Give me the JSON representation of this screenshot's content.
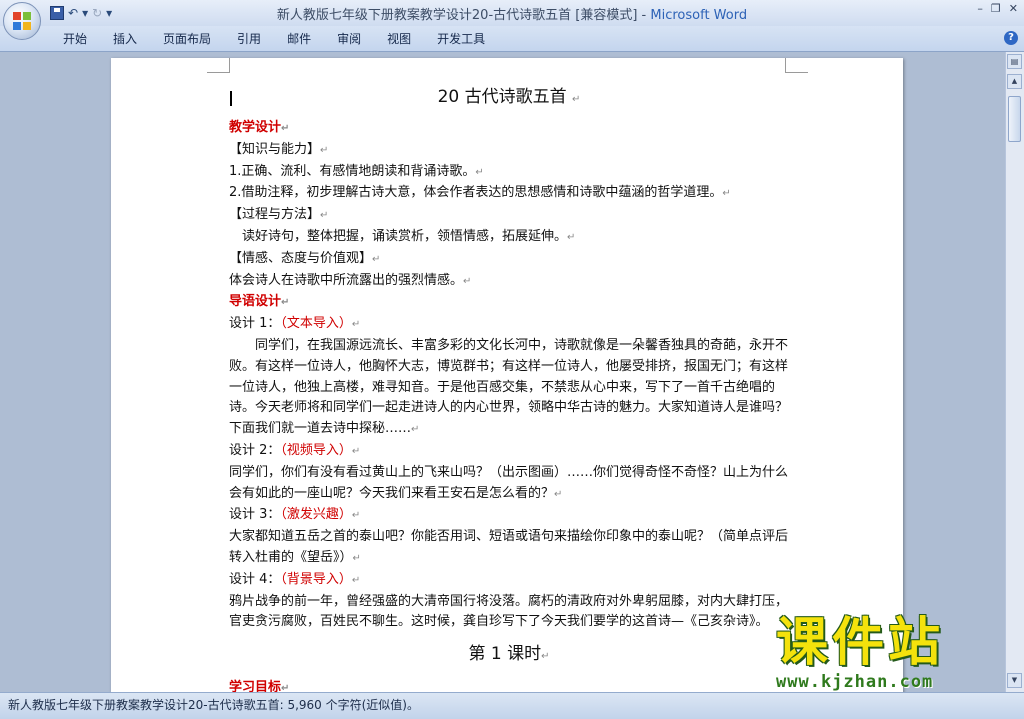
{
  "window": {
    "title": "新人教版七年级下册教案教学设计20-古代诗歌五首 [兼容模式] - ",
    "app_name": "Microsoft Word"
  },
  "qat": {
    "save": "save-icon",
    "undo": "↶",
    "undo_drop": "▾",
    "redo": "↻",
    "customize": "▾"
  },
  "window_controls": {
    "minimize": "–",
    "restore": "❐",
    "close": "✕"
  },
  "ribbon": {
    "tabs": [
      "开始",
      "插入",
      "页面布局",
      "引用",
      "邮件",
      "审阅",
      "视图",
      "开发工具"
    ],
    "help": "?"
  },
  "document": {
    "title": "20  古代诗歌五首",
    "pm": "↵",
    "lines": {
      "jxsj": "教学设计",
      "zsnl": "【知识与能力】",
      "zsnl_1": "1.正确、流利、有感情地朗读和背诵诗歌。",
      "zsnl_2": "2.借助注释，初步理解古诗大意，体会作者表达的思想感情和诗歌中蕴涵的哲学道理。",
      "gcff": "【过程与方法】",
      "gcff_1": "读好诗句，整体把握，诵读赏析，领悟情感，拓展延伸。",
      "qgtd": "【情感、态度与价值观】",
      "qgtd_1": "体会诗人在诗歌中所流露出的强烈情感。",
      "dysj": "导语设计",
      "sj1_label": "设计 1：",
      "sj1_type": "（文本导入）",
      "sj1_text": "同学们，在我国源远流长、丰富多彩的文化长河中，诗歌就像是一朵馨香独具的奇葩，永开不败。有这样一位诗人，他胸怀大志，博览群书；有这样一位诗人，他屡受排挤，报国无门；有这样一位诗人，他独上高楼，难寻知音。于是他百感交集，不禁悲从心中来，写下了一首千古绝唱的诗。今天老师将和同学们一起走进诗人的内心世界，领略中华古诗的魅力。大家知道诗人是谁吗？下面我们就一道去诗中探秘……",
      "sj2_label": "设计 2：",
      "sj2_type": "（视频导入）",
      "sj2_text": "同学们，你们有没有看过黄山上的飞来山吗？（出示图画）……你们觉得奇怪不奇怪？山上为什么会有如此的一座山呢？今天我们来看王安石是怎么看的？",
      "sj3_label": "设计 3：",
      "sj3_type": "（激发兴趣）",
      "sj3_text": "大家都知道五岳之首的泰山吧？你能否用词、短语或语句来描绘你印象中的泰山呢？（简单点评后转入杜甫的《望岳》）",
      "sj4_label": " 设计 4：",
      "sj4_type": "（背景导入）",
      "sj4_text": "鸦片战争的前一年，曾经强盛的大清帝国行将没落。腐朽的清政府对外卑躬屈膝，对内大肆打压，官吏贪污腐败，百姓民不聊生。这时候，龚自珍写下了今天我们要学的这首诗—《己亥杂诗》。",
      "lesson1": "第 1 课时",
      "xxmb": "学习目标"
    }
  },
  "statusbar": {
    "text": "新人教版七年级下册教案教学设计20-古代诗歌五首: 5,960 个字符(近似值)。"
  },
  "watermark": {
    "text": "课件站",
    "url": "www.kjzhan.com"
  },
  "colors": {
    "accent_red": "#d00000",
    "brand_blue": "#2d62b6",
    "watermark_yellow": "#f4e20c",
    "watermark_green": "#2f7a1d"
  }
}
